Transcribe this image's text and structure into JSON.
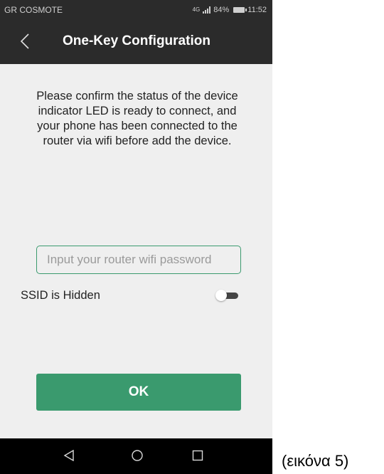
{
  "status_bar": {
    "carrier": "GR COSMOTE",
    "network": "4G",
    "battery": "84%",
    "time": "11:52"
  },
  "header": {
    "back_icon": "chevron-left-icon",
    "title": "One-Key Configuration"
  },
  "main": {
    "notice": "Please confirm the status of the device indicator LED is ready to connect, and your phone has been connected to the router via wifi before add the device.",
    "password_input": {
      "value": "",
      "placeholder": "Input your router wifi password"
    },
    "ssid_hidden": {
      "label": "SSID is Hidden",
      "enabled": false
    },
    "ok_label": "OK"
  },
  "nav_bar": {
    "back_icon": "triangle-back-icon",
    "home_icon": "circle-home-icon",
    "recents_icon": "square-recents-icon"
  },
  "caption": "(εικόνα 5)",
  "colors": {
    "header_bg": "#2b2b2b",
    "accent_green": "#3a9a6e",
    "content_bg": "#efefef"
  }
}
